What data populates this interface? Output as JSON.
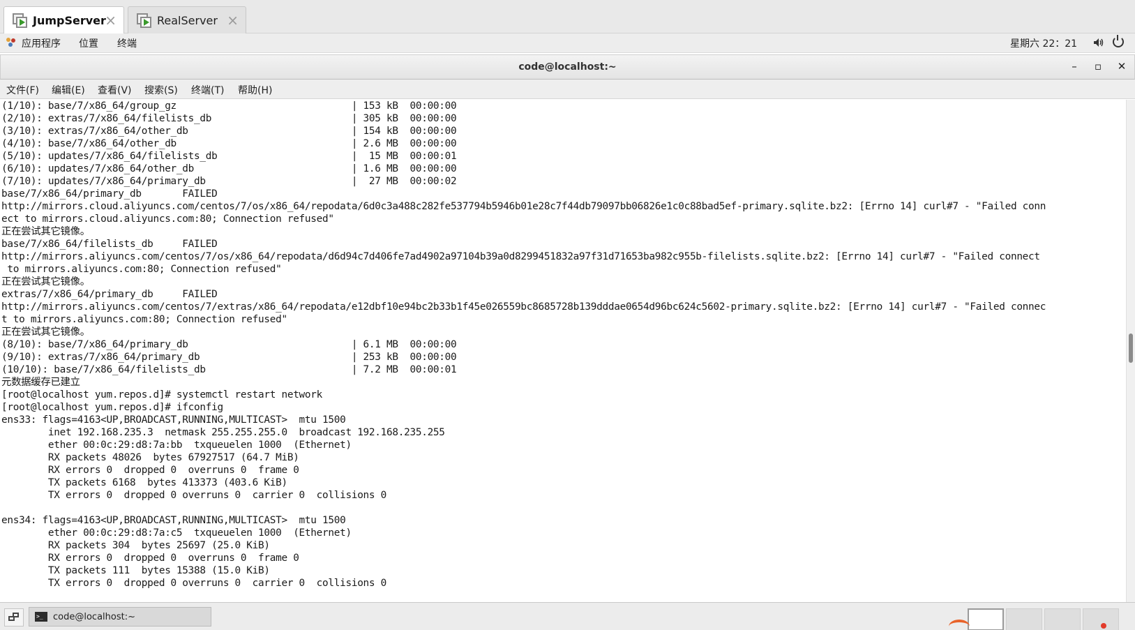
{
  "vm_tabs": [
    {
      "label": "JumpServer",
      "active": true
    },
    {
      "label": "RealServer",
      "active": false
    }
  ],
  "topbar": {
    "apps_label": "应用程序",
    "places_label": "位置",
    "terminal_label": "终端",
    "clock": "星期六 22：21",
    "icons": [
      "apps-icon",
      "volume-icon",
      "power-icon"
    ]
  },
  "window": {
    "title": "code@localhost:~",
    "minimize": "–",
    "maximize": "▫",
    "close": "✕"
  },
  "menubar": {
    "items": [
      "文件(F)",
      "编辑(E)",
      "查看(V)",
      "搜索(S)",
      "终端(T)",
      "帮助(H)"
    ]
  },
  "terminal": {
    "lines": [
      "(1/10): base/7/x86_64/group_gz                              | 153 kB  00:00:00",
      "(2/10): extras/7/x86_64/filelists_db                        | 305 kB  00:00:00",
      "(3/10): extras/7/x86_64/other_db                            | 154 kB  00:00:00",
      "(4/10): base/7/x86_64/other_db                              | 2.6 MB  00:00:00",
      "(5/10): updates/7/x86_64/filelists_db                       |  15 MB  00:00:01",
      "(6/10): updates/7/x86_64/other_db                           | 1.6 MB  00:00:00",
      "(7/10): updates/7/x86_64/primary_db                         |  27 MB  00:00:02",
      "base/7/x86_64/primary_db       FAILED",
      "http://mirrors.cloud.aliyuncs.com/centos/7/os/x86_64/repodata/6d0c3a488c282fe537794b5946b01e28c7f44db79097bb06826e1c0c88bad5ef-primary.sqlite.bz2: [Errno 14] curl#7 - \"Failed conn",
      "ect to mirrors.cloud.aliyuncs.com:80; Connection refused\"",
      "正在尝试其它镜像。",
      "base/7/x86_64/filelists_db     FAILED",
      "http://mirrors.aliyuncs.com/centos/7/os/x86_64/repodata/d6d94c7d406fe7ad4902a97104b39a0d8299451832a97f31d71653ba982c955b-filelists.sqlite.bz2: [Errno 14] curl#7 - \"Failed connect",
      " to mirrors.aliyuncs.com:80; Connection refused\"",
      "正在尝试其它镜像。",
      "extras/7/x86_64/primary_db     FAILED",
      "http://mirrors.aliyuncs.com/centos/7/extras/x86_64/repodata/e12dbf10e94bc2b33b1f45e026559bc8685728b139dddae0654d96bc624c5602-primary.sqlite.bz2: [Errno 14] curl#7 - \"Failed connec",
      "t to mirrors.aliyuncs.com:80; Connection refused\"",
      "正在尝试其它镜像。",
      "(8/10): base/7/x86_64/primary_db                            | 6.1 MB  00:00:00",
      "(9/10): extras/7/x86_64/primary_db                          | 253 kB  00:00:00",
      "(10/10): base/7/x86_64/filelists_db                         | 7.2 MB  00:00:01",
      "元数据缓存已建立",
      "[root@localhost yum.repos.d]# systemctl restart network",
      "[root@localhost yum.repos.d]# ifconfig",
      "ens33: flags=4163<UP,BROADCAST,RUNNING,MULTICAST>  mtu 1500",
      "        inet 192.168.235.3  netmask 255.255.255.0  broadcast 192.168.235.255",
      "        ether 00:0c:29:d8:7a:bb  txqueuelen 1000  (Ethernet)",
      "        RX packets 48026  bytes 67927517 (64.7 MiB)",
      "        RX errors 0  dropped 0  overruns 0  frame 0",
      "        TX packets 6168  bytes 413373 (403.6 KiB)",
      "        TX errors 0  dropped 0 overruns 0  carrier 0  collisions 0",
      "",
      "ens34: flags=4163<UP,BROADCAST,RUNNING,MULTICAST>  mtu 1500",
      "        ether 00:0c:29:d8:7a:c5  txqueuelen 1000  (Ethernet)",
      "        RX packets 304  bytes 25697 (25.0 KiB)",
      "        RX errors 0  dropped 0  overruns 0  frame 0",
      "        TX packets 111  bytes 15388 (15.0 KiB)",
      "        TX errors 0  dropped 0 overruns 0  carrier 0  collisions 0"
    ]
  },
  "taskbar": {
    "task_label": "code@localhost:~",
    "workspaces": 4,
    "active_workspace": 1
  },
  "colors": {
    "accent_green": "#3b9a2c",
    "terminal_bg": "#ffffff",
    "terminal_fg": "#1a1a1a"
  }
}
